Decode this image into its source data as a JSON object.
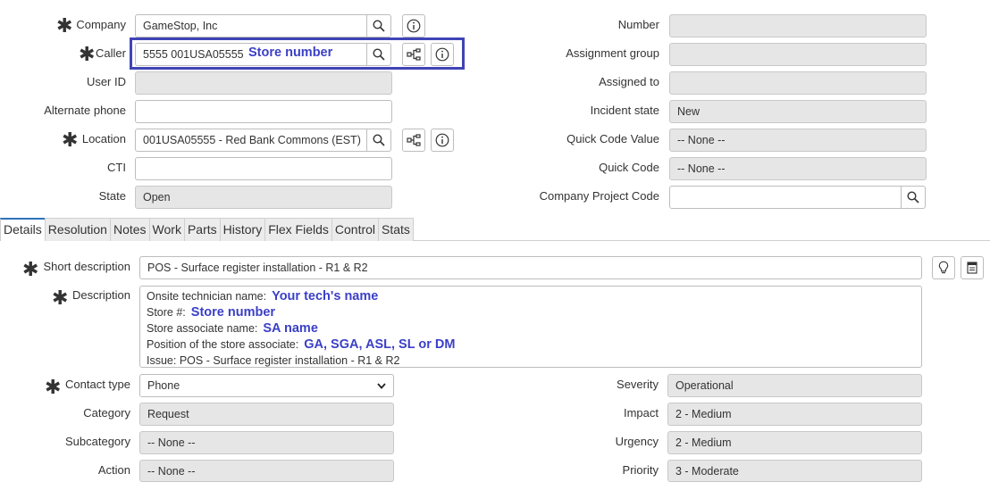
{
  "left_fields": {
    "company": {
      "label": "Company",
      "value": "GameStop, Inc"
    },
    "caller": {
      "label": "Caller",
      "value": "5555 001USA05555",
      "annotation": "Store number"
    },
    "user_id": {
      "label": "User ID",
      "value": ""
    },
    "alternate_phone": {
      "label": "Alternate phone",
      "value": ""
    },
    "location": {
      "label": "Location",
      "value": "001USA05555 - Red Bank Commons (EST)"
    },
    "cti": {
      "label": "CTI",
      "value": ""
    },
    "state": {
      "label": "State",
      "value": "Open"
    }
  },
  "right_fields": {
    "number": {
      "label": "Number",
      "value": ""
    },
    "assignment_group": {
      "label": "Assignment group",
      "value": ""
    },
    "assigned_to": {
      "label": "Assigned to",
      "value": ""
    },
    "incident_state": {
      "label": "Incident state",
      "value": "New"
    },
    "quick_code_value": {
      "label": "Quick Code Value",
      "value": "-- None --"
    },
    "quick_code": {
      "label": "Quick Code",
      "value": "-- None --"
    },
    "company_project_code": {
      "label": "Company Project Code",
      "value": ""
    }
  },
  "tabs": [
    "Details",
    "Resolution",
    "Notes",
    "Work",
    "Parts",
    "History",
    "Flex Fields",
    "Control",
    "Stats"
  ],
  "details": {
    "short_description": {
      "label": "Short description",
      "value": "POS - Surface register installation - R1 & R2"
    },
    "description": {
      "label": "Description",
      "lines": [
        {
          "text": "Onsite technician name:",
          "highlight": "Your tech's name"
        },
        {
          "text": "Store #:",
          "highlight": "Store number"
        },
        {
          "text": "Store associate name:",
          "highlight": "SA name"
        },
        {
          "text": "Position of the store associate:",
          "highlight": "GA, SGA, ASL, SL or DM"
        },
        {
          "text": "Issue: POS - Surface register installation - R1 & R2",
          "highlight": ""
        }
      ]
    },
    "contact_type": {
      "label": "Contact type",
      "value": "Phone"
    },
    "category": {
      "label": "Category",
      "value": "Request"
    },
    "subcategory": {
      "label": "Subcategory",
      "value": "-- None --"
    },
    "action": {
      "label": "Action",
      "value": "-- None --"
    },
    "severity": {
      "label": "Severity",
      "value": "Operational"
    },
    "impact": {
      "label": "Impact",
      "value": "2 - Medium"
    },
    "urgency": {
      "label": "Urgency",
      "value": "2 - Medium"
    },
    "priority": {
      "label": "Priority",
      "value": "3 - Moderate"
    }
  },
  "colors": {
    "annotation": "#3b3fc6",
    "callout_border": "#3f44b5",
    "readonly_bg": "#e6e6e6",
    "active_tab": "#2e72b9"
  },
  "icons": [
    "search-icon",
    "info-icon",
    "hierarchy-icon",
    "lightbulb-icon",
    "template-icon",
    "required-asterisk",
    "chevron-down-icon"
  ]
}
